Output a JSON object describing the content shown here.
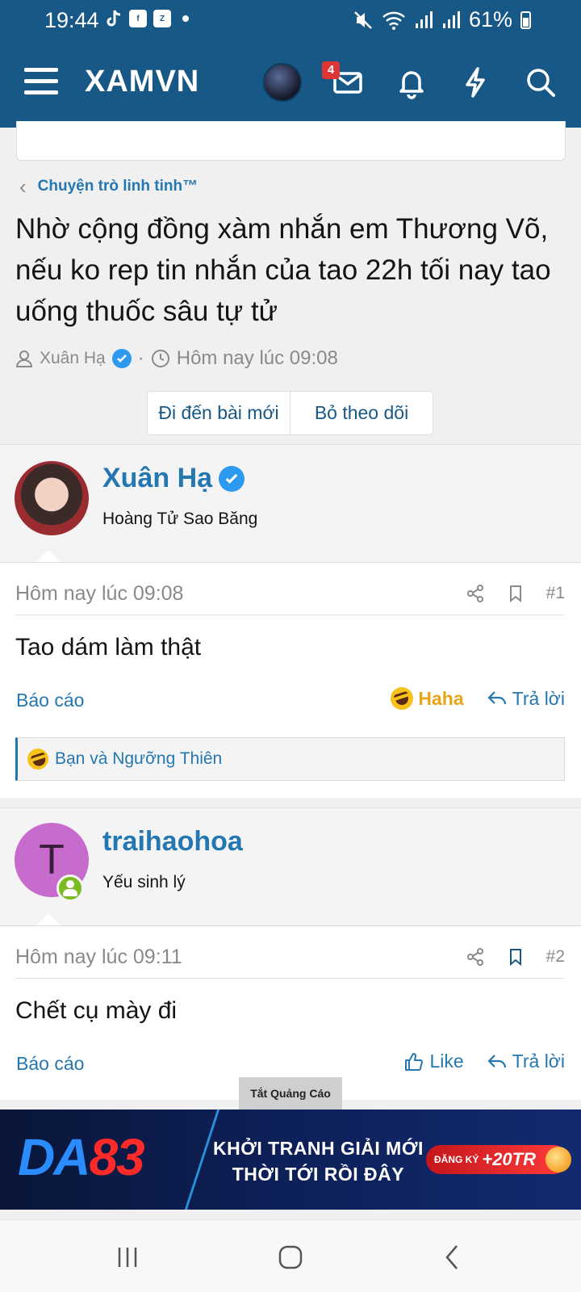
{
  "status_bar": {
    "time": "19:44",
    "battery": "61%"
  },
  "header": {
    "logo": "XAMVN",
    "notification_badge": "4"
  },
  "breadcrumb": {
    "label": "Chuyện trò linh tinh™"
  },
  "thread": {
    "title": "Nhờ cộng đồng xàm nhắn em Thương Võ, nếu ko rep tin nhắn của tao 22h tối nay tao uống thuốc sâu tự tử",
    "author": "Xuân Hạ",
    "separator": "·",
    "date": "Hôm nay lúc 09:08",
    "buttons": {
      "go_new": "Đi đến bài mới",
      "unwatch": "Bỏ theo dõi"
    }
  },
  "posts": [
    {
      "username": "Xuân Hạ",
      "user_title": "Hoàng Tử Sao Băng",
      "date": "Hôm nay lúc 09:08",
      "number": "#1",
      "content": "Tao dám làm thật",
      "report": "Báo cáo",
      "reaction_label": "Haha",
      "reply": "Trả lời",
      "reactions_summary": "Bạn và Ngưỡng Thiên"
    },
    {
      "username": "traihaohoa",
      "avatar_letter": "T",
      "user_title": "Yếu sinh lý",
      "date": "Hôm nay lúc 09:11",
      "number": "#2",
      "content": "Chết cụ mày đi",
      "report": "Báo cáo",
      "like": "Like",
      "reply": "Trả lời"
    }
  ],
  "ad": {
    "close_label": "Tắt Quảng Cáo",
    "logo_da": "DA",
    "logo_num": "83",
    "line1": "KHỞI TRANH GIẢI MỚI",
    "line2": "THỜI TỚI RỒI ĐÂY",
    "cta_label": "ĐĂNG KÝ",
    "cta_amount": "+20TR"
  },
  "colors": {
    "header_bg": "#185886",
    "link": "#2577b1",
    "haha": "#e8a517",
    "badge": "#e03535",
    "online": "#7cba22"
  },
  "icons": {
    "status": [
      "tiktok-icon",
      "facebook-icon",
      "zalo-icon",
      "mute-icon",
      "wifi-icon",
      "signal-icon",
      "battery-icon"
    ],
    "header": [
      "menu-icon",
      "avatar",
      "inbox-icon",
      "bell-icon",
      "bolt-icon",
      "search-icon"
    ],
    "post": [
      "share-icon",
      "bookmark-icon",
      "reply-icon",
      "like-icon",
      "haha-emoji-icon"
    ],
    "nav": [
      "recents-icon",
      "home-icon",
      "back-icon"
    ]
  }
}
